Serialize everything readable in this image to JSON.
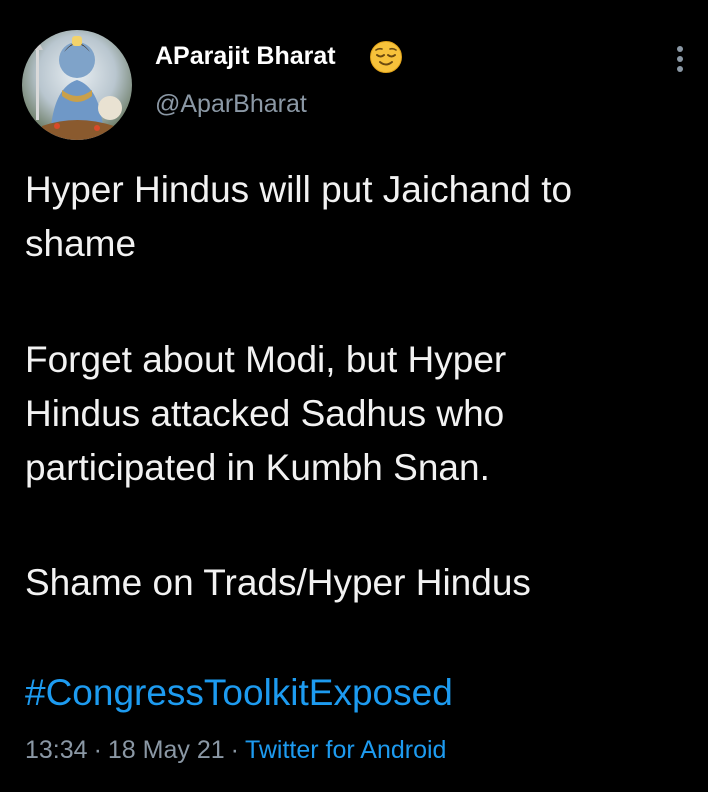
{
  "tweet": {
    "display_name": "AParajit Bharat",
    "handle": "@AparBharat",
    "author_emoji": "relieved-face",
    "text_lines": [
      "Hyper Hindus will put Jaichand to",
      "shame",
      "Forget about Modi, but Hyper",
      "Hindus attacked Sadhus who",
      "participated in Kumbh Snan.",
      "Shame on Trads/Hyper Hindus"
    ],
    "hashtag": "#CongressToolkitExposed",
    "time": "13:34",
    "date": "18 May 21",
    "separator": "·",
    "source": "Twitter for Android"
  },
  "colors": {
    "background": "#000000",
    "text": "#f2f2f2",
    "muted": "#8b98a5",
    "link": "#1d9bf0"
  }
}
